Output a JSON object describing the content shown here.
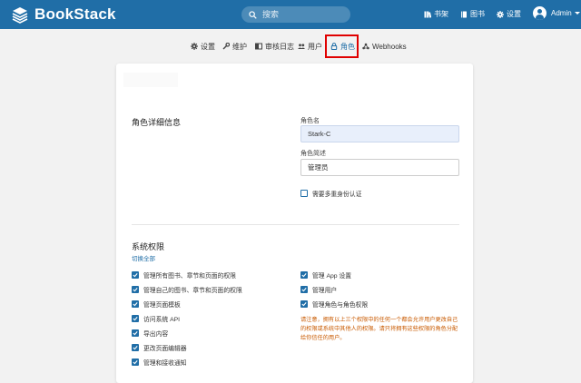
{
  "header": {
    "app_name": "BookStack",
    "search_placeholder": "搜索",
    "nav": [
      {
        "label": "书架",
        "icon": "shelf-icon"
      },
      {
        "label": "图书",
        "icon": "book-icon"
      },
      {
        "label": "设置",
        "icon": "gear-icon"
      }
    ],
    "user_name": "Admin"
  },
  "tabs": [
    {
      "label": "设置",
      "icon": "gear-icon",
      "active": false
    },
    {
      "label": "维护",
      "icon": "wrench-icon",
      "active": false
    },
    {
      "label": "审核日志",
      "icon": "audit-icon",
      "active": false
    },
    {
      "label": "用户",
      "icon": "users-icon",
      "active": false
    },
    {
      "label": "角色",
      "icon": "lock-icon",
      "active": true
    },
    {
      "label": "Webhooks",
      "icon": "webhook-icon",
      "active": false
    }
  ],
  "details": {
    "section_title": "角色详细信息",
    "role_name_label": "角色名",
    "role_name_value": "Stark-C",
    "role_desc_label": "角色简述",
    "role_desc_value": "管理员",
    "mfa_label": "需要多重身份认证",
    "mfa_checked": false
  },
  "system_permissions": {
    "section_title": "系统权限",
    "toggle_all": "切换全部",
    "left": [
      {
        "label": "管理所有图书、章节和页面的权限",
        "checked": true
      },
      {
        "label": "管理自己的图书、章节和页面的权限",
        "checked": true
      },
      {
        "label": "管理页面模板",
        "checked": true
      },
      {
        "label": "访问系统 API",
        "checked": true
      },
      {
        "label": "导出内容",
        "checked": true
      },
      {
        "label": "更改页面编辑器",
        "checked": true
      },
      {
        "label": "管理和接收通知",
        "checked": true
      }
    ],
    "right": [
      {
        "label": "管理 App 设置",
        "checked": true
      },
      {
        "label": "管理用户",
        "checked": true
      },
      {
        "label": "管理角色与角色权限",
        "checked": true
      }
    ],
    "warning": "请注意，拥有以上三个权限中的任何一个都会允许用户更改自己的权限或系统中其他人的权限。请只将拥有这些权限的角色分配给你信任的用户。"
  },
  "colors": {
    "brand": "#206ea7",
    "highlight": "#e00000",
    "warning": "#c95a00"
  }
}
